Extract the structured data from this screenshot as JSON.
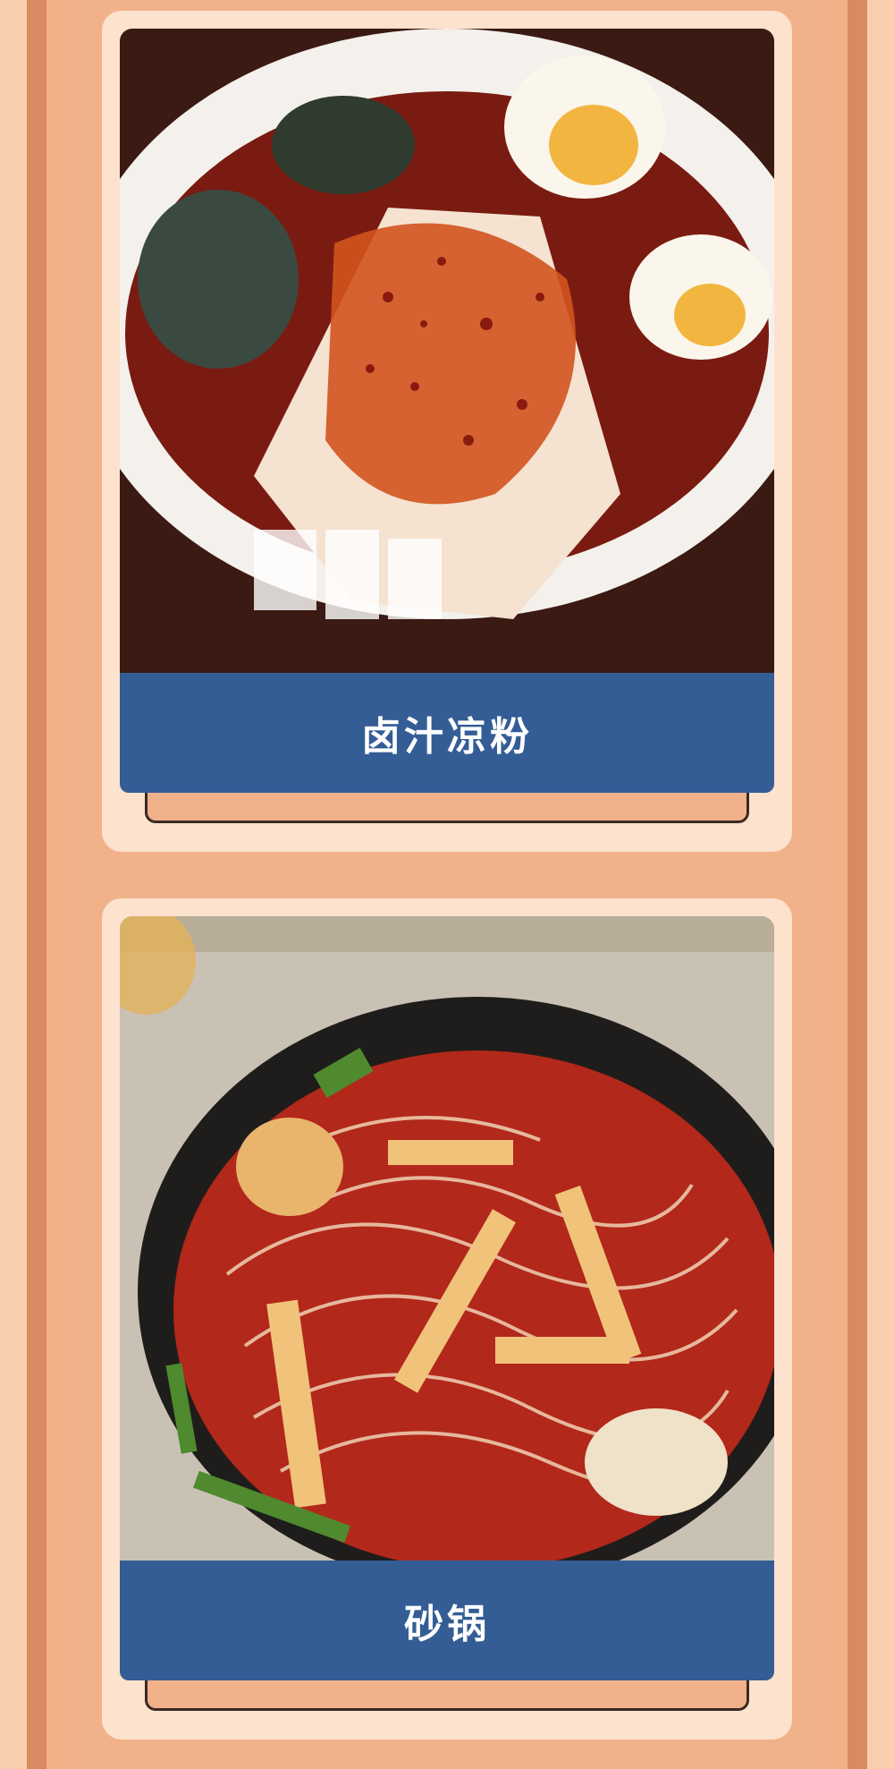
{
  "dishes": [
    {
      "name": "卤汁凉粉",
      "image": "liangfen-food-photo"
    },
    {
      "name": "砂锅",
      "image": "claypot-noodle-food-photo"
    }
  ],
  "colors": {
    "label_bar": "#345d95",
    "card_bg": "#fde2cd",
    "stripe_dark": "#d88a62",
    "stripe_light": "#f9cfae"
  }
}
